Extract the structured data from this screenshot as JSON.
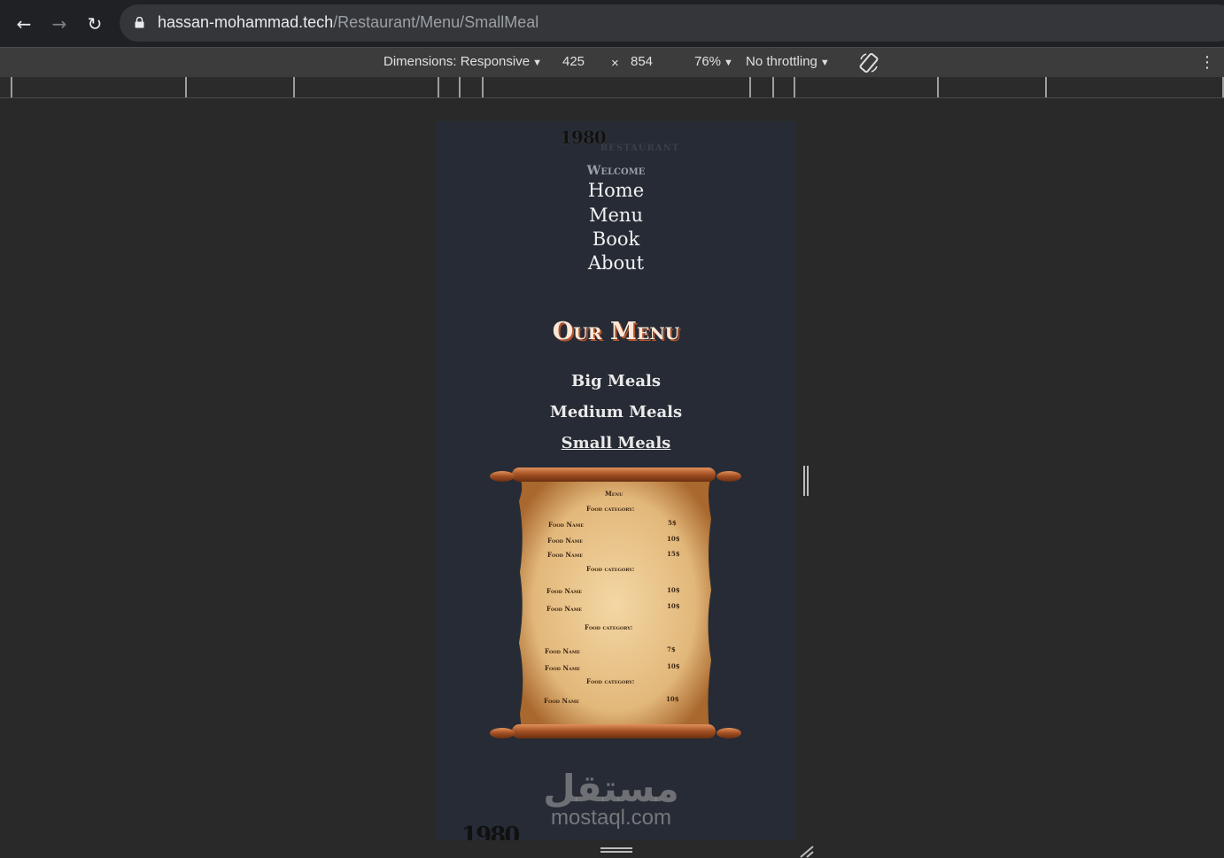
{
  "browser": {
    "url_host": "hassan-mohammad.tech",
    "url_path": "/Restaurant/Menu/SmallMeal",
    "back_icon": "←",
    "forward_icon": "→",
    "reload_icon": "↻"
  },
  "device_toolbar": {
    "dimensions_label": "Dimensions: Responsive",
    "width": "425",
    "times": "×",
    "height": "854",
    "zoom": "76%",
    "throttling": "No throttling",
    "more_icon": "⋮"
  },
  "site": {
    "brand": "1980",
    "brand_sub": "RESTAURANT",
    "welcome": "Welcome",
    "nav": [
      "Home",
      "Menu",
      "Book",
      "About"
    ],
    "menu_title": "Our Menu",
    "categories": [
      "Big Meals",
      "Medium Meals",
      "Small Meals"
    ],
    "active_category": "Small Meals",
    "scroll_menu": {
      "heading": "Menu",
      "sections": [
        {
          "category": "Food category:",
          "items": [
            {
              "name": "Food Name",
              "price": "5$"
            },
            {
              "name": "Food Name",
              "price": "10$"
            },
            {
              "name": "Food Name",
              "price": "15$"
            }
          ]
        },
        {
          "category": "Food category:",
          "items": [
            {
              "name": "Food Name",
              "price": "10$"
            },
            {
              "name": "Food Name",
              "price": "10$"
            }
          ]
        },
        {
          "category": "Food category:",
          "items": [
            {
              "name": "Food Name",
              "price": "7$"
            },
            {
              "name": "Food Name",
              "price": "10$"
            }
          ]
        },
        {
          "category": "Food category:",
          "items": [
            {
              "name": "Food Name",
              "price": "10$"
            }
          ]
        }
      ]
    },
    "footer_clip": "1980"
  },
  "watermark": {
    "arabic": "مستقل",
    "latin": "mostaql.com"
  },
  "colors": {
    "viewport_bg": "#262b35",
    "title_shadow": "#b4532a",
    "parchment": "#e8c188"
  }
}
